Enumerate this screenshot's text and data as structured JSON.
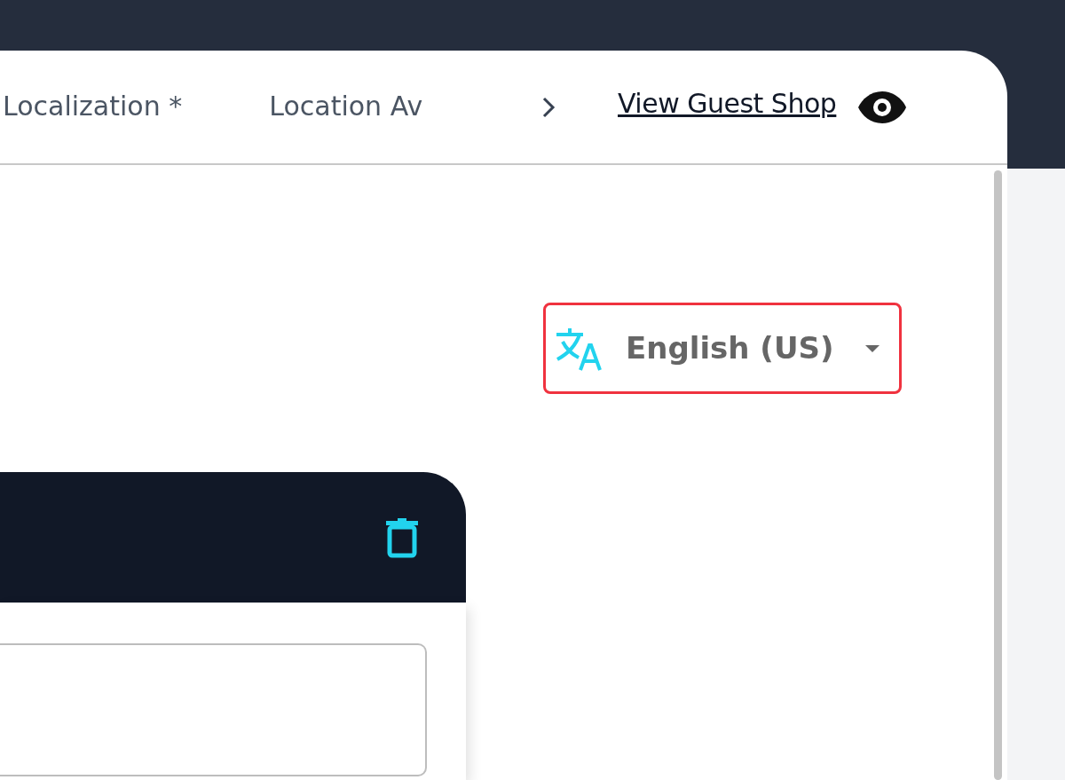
{
  "tabs": [
    {
      "label": "Localization *",
      "selected": false
    },
    {
      "label": "Location Av",
      "selected": false
    }
  ],
  "guest_link": {
    "label": "View Guest Shop"
  },
  "language_selector": {
    "value": "English (US)",
    "highlighted": true
  }
}
